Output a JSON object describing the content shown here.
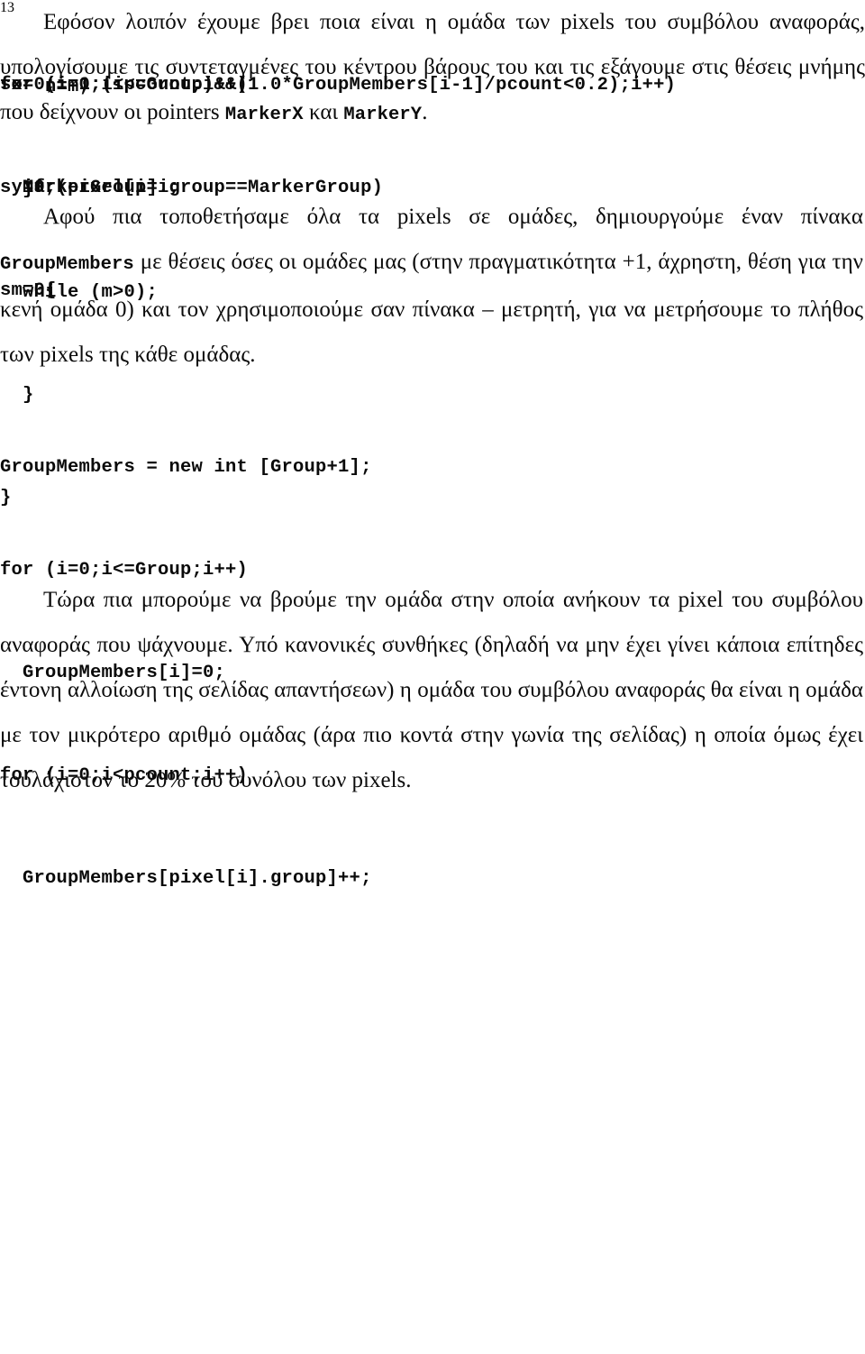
{
  "page": {
    "number": "13",
    "language": "el"
  },
  "blocks": {
    "code_top": {
      "name": "code-block-while-loop",
      "lines": [
        "    n=m;",
        "  }",
        "  while (m>0);",
        "  }",
        "}"
      ]
    },
    "paragraph_1": {
      "text": "Αφού πια τοποθετήσαμε όλα τα pixels σε ομάδες, δημιουργούμε έναν πίνακα GroupMembers με θέσεις όσες οι ομάδες μας (στην πραγματικότητα +1, άχρηστη, θέση για την κενή ομάδα 0) και τον χρησιμοποιούμε σαν πίνακα – μετρητή, για να μετρήσουμε το πλήθος των pixels της κάθε ομάδας.",
      "segments": [
        {
          "type": "text",
          "value": "Αφού πια τοποθετήσαμε όλα τα pixels σε ομάδες, δημιουργούμε έναν πίνακα "
        },
        {
          "type": "mono",
          "value": "GroupMembers"
        },
        {
          "type": "text",
          "value": " με θέσεις όσες οι ομάδες μας (στην πραγματικότητα +1, άχρηστη, θέση για την κενή ομάδα 0) και τον χρησιμοποιούμε σαν πίνακα – μετρητή, για να μετρήσουμε το πλήθος των pixels της κάθε ομάδας."
        }
      ]
    },
    "code_groupmembers": {
      "name": "code-block-groupmembers-count",
      "lines": [
        "GroupMembers = new int [Group+1];",
        "for (i=0;i<=Group;i++)",
        "  GroupMembers[i]=0;",
        "for (i=0;i<pcount;i++)",
        "  GroupMembers[pixel[i].group]++;"
      ]
    },
    "paragraph_2": {
      "text": "Τώρα πια μπορούμε να βρούμε την ομάδα στην οποία ανήκουν τα pixel του συμβόλου αναφοράς που ψάχνουμε. Υπό κανονικές συνθήκες (δηλαδή να μην έχει γίνει κάποια επίτηδες έντονη αλλοίωση της σελίδας απαντήσεων) η ομάδα του συμβόλου αναφοράς θα είναι η ομάδα με τον μικρότερο αριθμό ομάδας (άρα πιο κοντά στην γωνία της σελίδας) η οποία όμως έχει τουλάχιστον το 20% του συνόλου των pixels."
    },
    "code_markergroup": {
      "name": "code-block-markergroup-search",
      "lines": [
        "for (i=1;(i<=Group)&&(1.0*GroupMembers[i-1]/pcount<0.2);i++)",
        "  MarkerGroup=i;"
      ]
    },
    "paragraph_3": {
      "segments": [
        {
          "type": "text",
          "value": "Εφόσον λοιπόν έχουμε βρει ποια είναι η ομάδα των pixels του συμβόλου αναφοράς, υπολογίσουμε τις συντεταγμένες του  κέντρου βάρους του και τις εξάγουμε στις θέσεις μνήμης που δείχνουν οι pointers "
        },
        {
          "type": "mono",
          "value": "MarkerX"
        },
        {
          "type": "text",
          "value": " και "
        },
        {
          "type": "mono",
          "value": "MarkerY"
        },
        {
          "type": "text",
          "value": "."
        }
      ],
      "text": "Εφόσον λοιπόν έχουμε βρει ποια είναι η ομάδα των pixels του συμβόλου αναφοράς, υπολογίσουμε τις συντεταγμένες του κέντρου βάρους του και τις εξάγουμε στις θέσεις μνήμης που δείχνουν οι pointers MarkerX και MarkerY."
    },
    "code_sums": {
      "name": "code-block-sum-init",
      "lines": [
        "sx=0;",
        "sy=0;",
        "sm=0;"
      ]
    },
    "code_forloop": {
      "name": "code-block-centroid-loop",
      "lines": [
        "for (i=0;i<pcount;i++)",
        "  if (pixel[i].group==MarkerGroup)",
        "    {"
      ]
    }
  }
}
